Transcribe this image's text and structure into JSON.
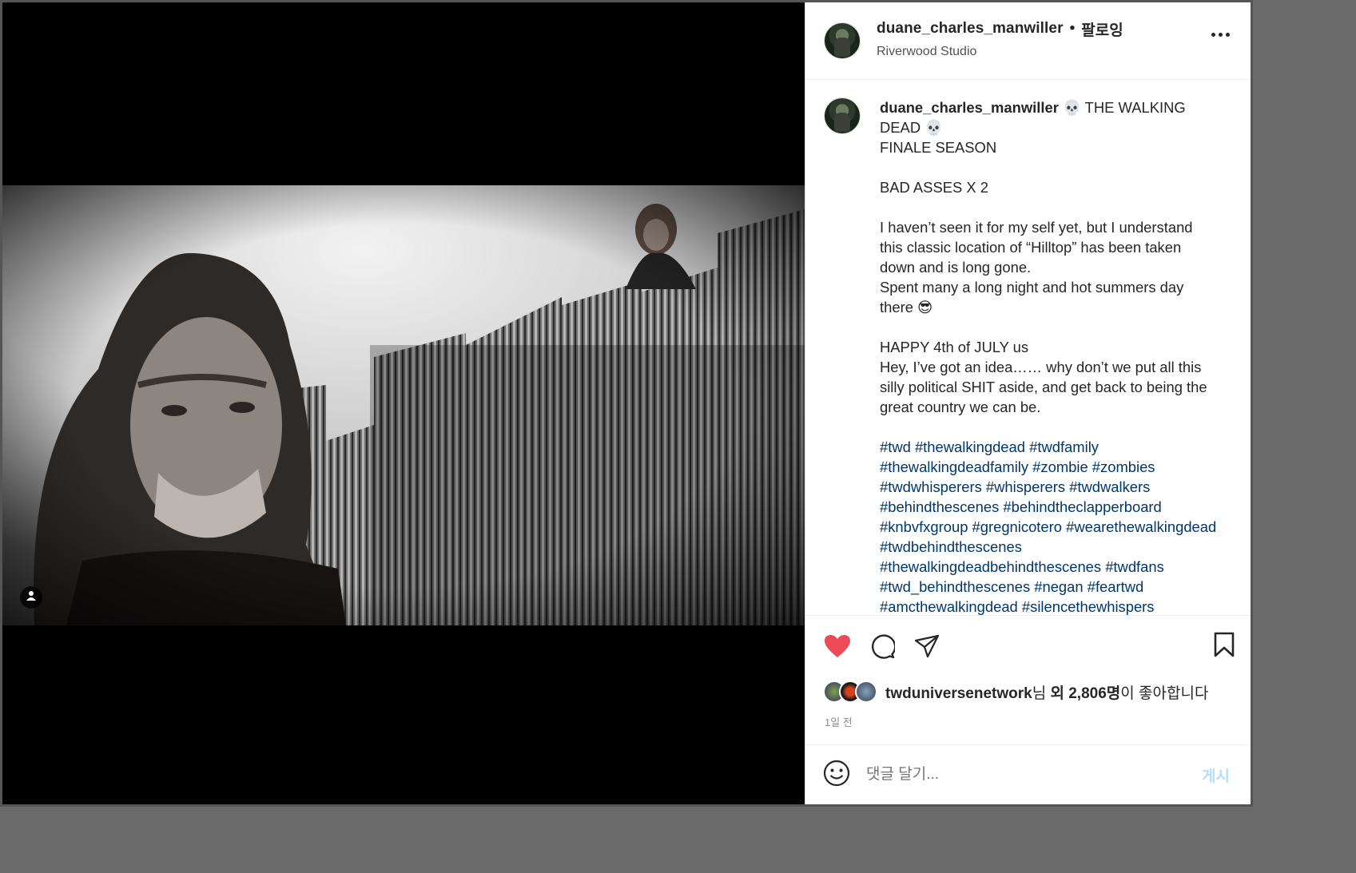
{
  "post": {
    "username": "duane_charles_manwiller",
    "separator": "•",
    "follow_label": "팔로잉",
    "location": "Riverwood Studio",
    "media_alt": "Black and white photo on the Walking Dead Hilltop set: a long-haired man in the foreground, a woman standing atop a corrugated metal wall behind him",
    "caption_user": "duane_charles_manwiller",
    "caption_text": " 💀 THE WALKING DEAD 💀\nFINALE SEASON\n\nBAD ASSES X 2\n\nI haven’t seen it for my self yet, but I understand this classic location of “Hilltop” has been taken down and is long gone.\nSpent many a long night and hot summers day there 😎\n\nHAPPY 4th of JULY us\nHey, I’ve got an idea…… why don’t we put all this silly political SHIT aside, and get back to being the great country we can be.\n\n",
    "hashtags": "#twd #thewalkingdead #twdfamily #thewalkingdeadfamily #zombie #zombies #twdwhisperers #whisperers #twdwalkers #behindthescenes #behindtheclapperboard #knbvfxgroup #gregnicotero #wearethewalkingdead #twdbehindthescenes #thewalkingdeadbehindthescenes #twdfans #twd_behindthescenes #negan #feartwd #amcthewalkingdead #silencethewhispers"
  },
  "likes": {
    "liker": "twduniversenetwork",
    "suffix_1": "님 ",
    "others": "외 2,806명",
    "suffix_2": "이 좋아합니다"
  },
  "timestamp": "1일 전",
  "comment": {
    "placeholder": "댓글 달기...",
    "post_label": "게시"
  },
  "colors": {
    "like_red": "#ed4956",
    "hashtag_blue": "#00376b",
    "post_button_disabled": "#b2dffc"
  },
  "icons": {
    "like": "heart-filled-icon",
    "comment": "speech-bubble-icon",
    "share": "paper-plane-icon",
    "save": "bookmark-icon",
    "emoji": "smiley-icon",
    "tag": "user-tag-icon",
    "more": "more-options-icon"
  }
}
